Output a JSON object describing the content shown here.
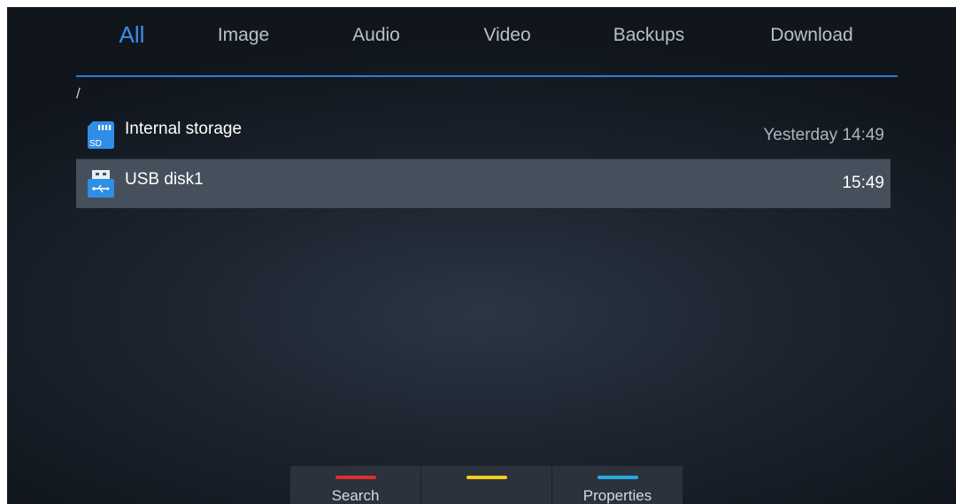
{
  "tabs": [
    {
      "label": "All",
      "active": true
    },
    {
      "label": "Image",
      "active": false
    },
    {
      "label": "Audio",
      "active": false
    },
    {
      "label": "Video",
      "active": false
    },
    {
      "label": "Backups",
      "active": false
    },
    {
      "label": "Download",
      "active": false
    }
  ],
  "path": "/",
  "files": [
    {
      "name": "Internal storage",
      "time": "Yesterday 14:49",
      "icon": "sd-card-icon",
      "selected": false
    },
    {
      "name": "USB disk1",
      "time": "15:49",
      "icon": "usb-drive-icon",
      "selected": true
    }
  ],
  "sd_badge": "SD",
  "bottom_buttons": [
    {
      "label": "Search",
      "color": "#e02d2d"
    },
    {
      "label": "",
      "color": "#f2cf1e"
    },
    {
      "label": "Properties",
      "color": "#29a9e3"
    }
  ],
  "colors": {
    "accent": "#3a8eea",
    "selected_row": "#46505d",
    "icon_blue": "#2f8fe6"
  }
}
